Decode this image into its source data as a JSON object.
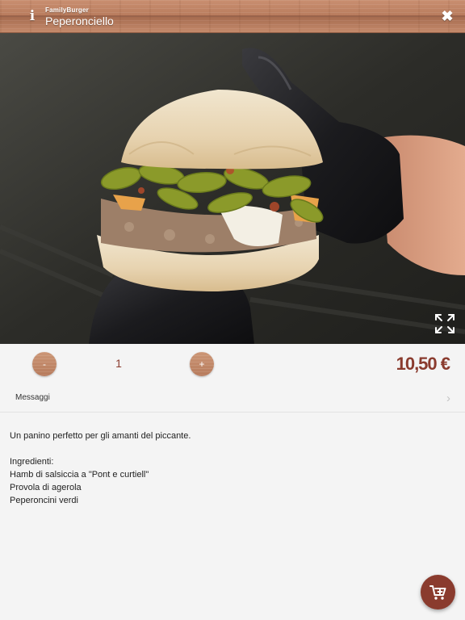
{
  "header": {
    "app_name": "FamilyBurger",
    "title": "Peperonciello",
    "info_icon": "info-icon",
    "close_icon": "close-icon"
  },
  "product_image": {
    "description_icon": "burger-photo",
    "expand_icon": "fullscreen-expand-icon"
  },
  "quantity": {
    "decrement_label": "-",
    "value": "1",
    "increment_label": "+"
  },
  "price": "10,50 €",
  "messages": {
    "label": "Messaggi",
    "chevron_icon": "chevron-right-icon"
  },
  "description": {
    "intro": "Un panino perfetto per gli amanti del piccante.",
    "ingredients_heading": "Ingredienti:",
    "ingredients": [
      "Hamb di salsiccia a \"Pont e curtiell\"",
      "Provola di agerola",
      "Peperoncini verdi"
    ]
  },
  "cart_button": {
    "icon": "add-to-cart-icon"
  },
  "colors": {
    "accent": "#8a3b2e",
    "header_wood": "#b97c5e",
    "background": "#f4f4f4"
  }
}
